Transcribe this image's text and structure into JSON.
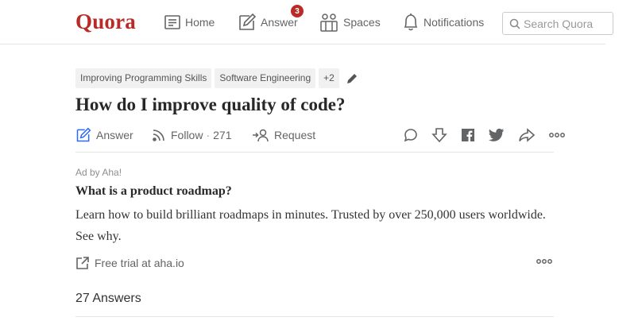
{
  "header": {
    "logo": "Quora",
    "nav": {
      "home": "Home",
      "answer": "Answer",
      "answer_badge": "3",
      "spaces": "Spaces",
      "notifications": "Notifications"
    },
    "search_placeholder": "Search Quora"
  },
  "question": {
    "topics": [
      "Improving Programming Skills",
      "Software Engineering",
      "+2"
    ],
    "title": "How do I improve quality of code?",
    "actions": {
      "answer": "Answer",
      "follow": "Follow",
      "follow_separator": "·",
      "follow_count": "271",
      "request": "Request"
    }
  },
  "ad": {
    "label": "Ad by Aha!",
    "title": "What is a product roadmap?",
    "body": "Learn how to build brilliant roadmaps in minutes. Trusted by over 250,000 users worldwide. See why.",
    "link": "Free trial at aha.io"
  },
  "answers": {
    "count_label": "27 Answers"
  },
  "colors": {
    "brand": "#b92b27",
    "icon": "#636466",
    "answer_icon": "#2e69ff"
  },
  "icons": [
    "home-icon",
    "answer-pencil-icon",
    "spaces-icon",
    "bell-icon",
    "search-icon",
    "edit-pencil-icon",
    "rss-follow-icon",
    "request-user-icon",
    "comment-icon",
    "downvote-icon",
    "facebook-icon",
    "twitter-icon",
    "share-icon",
    "more-icon",
    "external-link-icon"
  ]
}
